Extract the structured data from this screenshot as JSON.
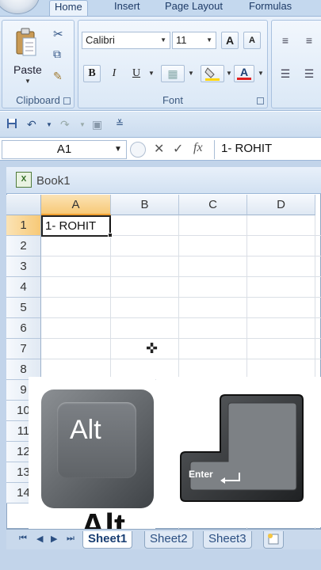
{
  "ribbon": {
    "tabs": [
      "Home",
      "Insert",
      "Page Layout",
      "Formulas"
    ],
    "clipboard": {
      "paste_label": "Paste",
      "group_label": "Clipboard"
    },
    "font": {
      "family": "Calibri",
      "size": "11",
      "group_label": "Font"
    },
    "bold": "B",
    "italic": "I",
    "underline": "U",
    "grow_font": "A",
    "shrink_font": "A",
    "font_color": "A"
  },
  "formula_bar": {
    "name_box": "A1",
    "fx": "fx",
    "content": "1- ROHIT"
  },
  "workbook": {
    "title": "Book1",
    "columns": [
      "A",
      "B",
      "C",
      "D"
    ],
    "rows": [
      "1",
      "2",
      "3",
      "4",
      "5",
      "6",
      "7",
      "8",
      "9",
      "10",
      "11",
      "12",
      "13",
      "14"
    ],
    "active_cell": {
      "ref": "A1",
      "value": "1- ROHIT"
    }
  },
  "overlay": {
    "alt_key_label": "Alt",
    "alt_caption": "Alt",
    "enter_key_label": "Enter"
  },
  "sheets": [
    "Sheet1",
    "Sheet2",
    "Sheet3"
  ],
  "colors": {
    "accent": "#f0a030",
    "ribbon": "#d4e3f4",
    "font_color_bar": "#e02020"
  }
}
